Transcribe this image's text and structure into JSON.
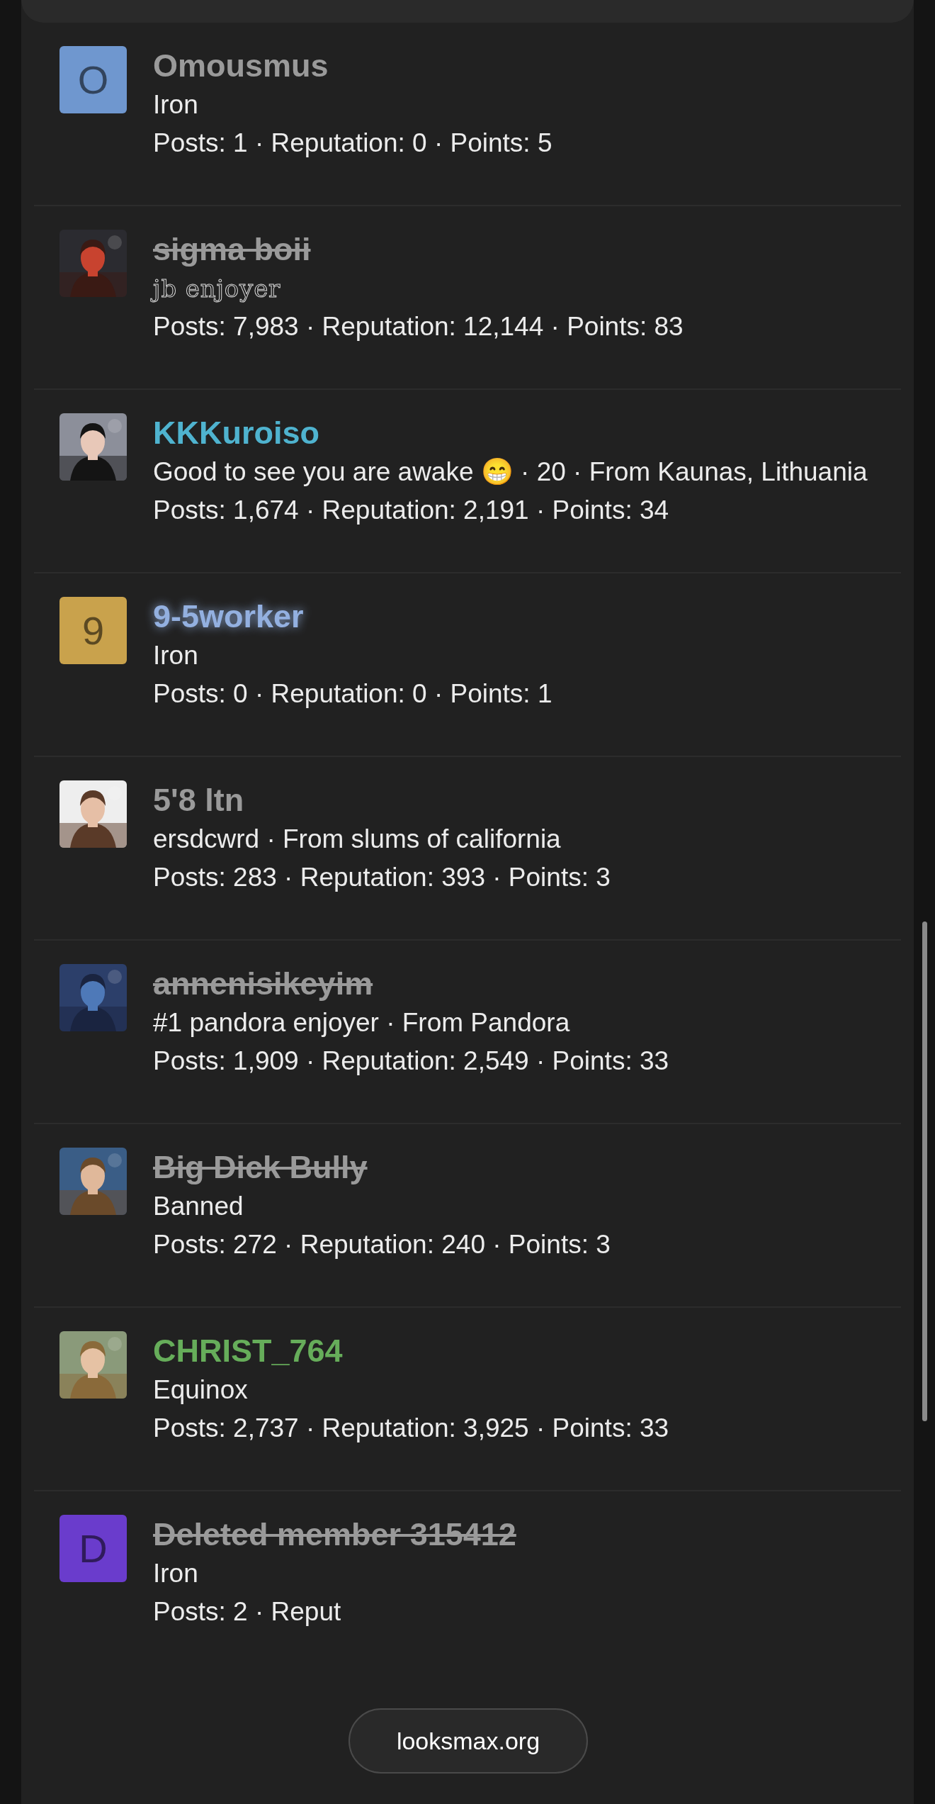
{
  "members": [
    {
      "name": "Omousmus",
      "color": "#9a9a9a",
      "banned": false,
      "glow": false,
      "avatar": {
        "kind": "letter",
        "letter": "O",
        "color": "#6f97cf"
      },
      "title": "Iron",
      "title_fancy": false,
      "stats": "Posts: 1 · Reputation: 0 · Points: 5"
    },
    {
      "name": "sigma boii",
      "color": "#9a9a9a",
      "banned": true,
      "glow": false,
      "title": "jb enjoyer",
      "title_fancy": true,
      "stats": "Posts: 7,983 · Reputation: 12,144 · Points: 83"
    },
    {
      "name": "KKKuroiso",
      "color": "#4fb3cf",
      "banned": false,
      "glow": false,
      "title": "Good to see you are awake 😁 · 20 · From Kaunas, Lithuania",
      "title_fancy": false,
      "stats": "Posts: 1,674 · Reputation: 2,191 · Points: 34"
    },
    {
      "name": "9-5worker",
      "color": "#93b0e0",
      "banned": false,
      "glow": true,
      "avatar": {
        "kind": "letter",
        "letter": "9",
        "color": "#c9a24c"
      },
      "title": "Iron",
      "title_fancy": false,
      "stats": "Posts: 0 · Reputation: 0 · Points: 1"
    },
    {
      "name": "5'8 ltn",
      "color": "#9a9a9a",
      "banned": false,
      "glow": false,
      "title": "ersdcwrd · From slums of california",
      "title_fancy": false,
      "stats": "Posts: 283 · Reputation: 393 · Points: 3"
    },
    {
      "name": "annenisikeyim",
      "color": "#9a9a9a",
      "banned": true,
      "glow": false,
      "title": "#1 pandora enjoyer · From Pandora",
      "title_fancy": false,
      "stats": "Posts: 1,909 · Reputation: 2,549 · Points: 33"
    },
    {
      "name": "Big Dick Bully",
      "color": "#9a9a9a",
      "banned": true,
      "glow": false,
      "title": "Banned",
      "title_fancy": false,
      "stats": "Posts: 272 · Reputation: 240 · Points: 3"
    },
    {
      "name": "CHRIST_764",
      "color": "#66ad5a",
      "banned": false,
      "glow": false,
      "title": "Equinox",
      "title_fancy": false,
      "stats": "Posts: 2,737 · Reputation: 3,925 · Points: 33"
    },
    {
      "name": "Deleted member 315412",
      "color": "#9a9a9a",
      "banned": true,
      "glow": false,
      "avatar": {
        "kind": "letter",
        "letter": "D",
        "color": "#6a3ccc"
      },
      "title": "Iron",
      "title_fancy": false,
      "stats": "Posts: 2 · Reput"
    }
  ],
  "site_pill": "looksmax.org"
}
